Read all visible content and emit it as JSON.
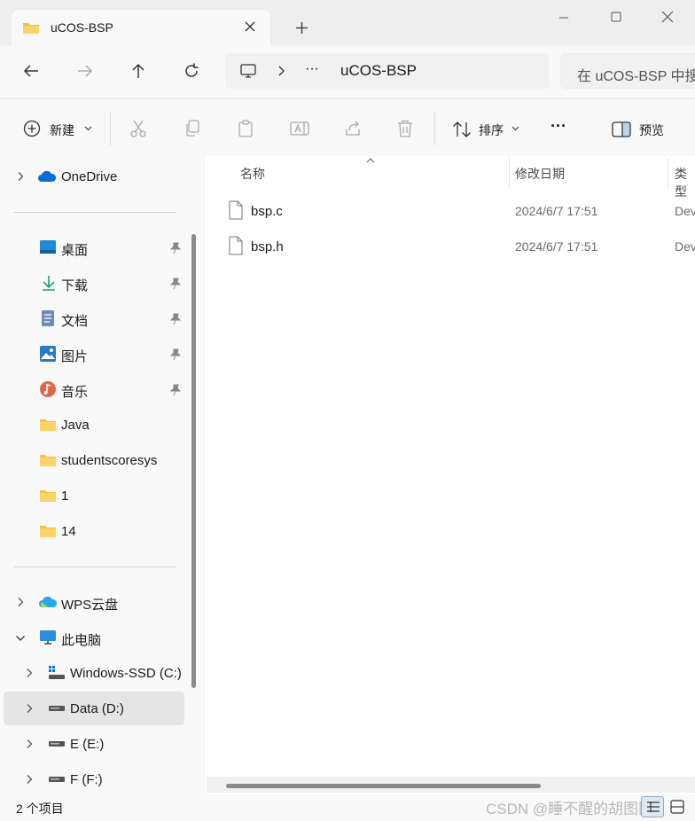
{
  "window": {
    "tab_title": "uCOS-BSP",
    "icons": {
      "minimize": "minimize-icon",
      "maximize": "maximize-icon",
      "close": "close-icon"
    }
  },
  "address": {
    "overflow": "···",
    "current": "uCOS-BSP",
    "search_placeholder": "在 uCOS-BSP 中搜索"
  },
  "toolbar": {
    "new_label": "新建",
    "sort_label": "排序",
    "more": "···",
    "preview_label": "预览"
  },
  "sidebar": {
    "onedrive": "OneDrive",
    "quick": [
      {
        "label": "桌面",
        "icon": "desktop-icon"
      },
      {
        "label": "下载",
        "icon": "download-icon"
      },
      {
        "label": "文档",
        "icon": "document-icon"
      },
      {
        "label": "图片",
        "icon": "pictures-icon"
      },
      {
        "label": "音乐",
        "icon": "music-icon"
      },
      {
        "label": "Java",
        "icon": "folder-icon"
      },
      {
        "label": "studentscoresys",
        "icon": "folder-icon"
      },
      {
        "label": "1",
        "icon": "folder-icon"
      },
      {
        "label": "14",
        "icon": "folder-icon"
      }
    ],
    "wps": "WPS云盘",
    "this_pc": "此电脑",
    "drives": [
      {
        "label": "Windows-SSD (C:)"
      },
      {
        "label": "Data (D:)",
        "selected": true
      },
      {
        "label": "E (E:)"
      },
      {
        "label": "F (F:)"
      }
    ]
  },
  "columns": {
    "name": "名称",
    "date": "修改日期",
    "type": "类型"
  },
  "files": [
    {
      "name": "bsp.c",
      "date": "2024/6/7 17:51",
      "type": "Dev-C++"
    },
    {
      "name": "bsp.h",
      "date": "2024/6/7 17:51",
      "type": "Dev-C++"
    }
  ],
  "status": {
    "count": "2 个项目",
    "watermark": "CSDN @睡不醒的胡图图"
  },
  "colors": {
    "accent": "#0067c0",
    "folder": "#f8c23c",
    "selection": "#e5e5e5"
  }
}
